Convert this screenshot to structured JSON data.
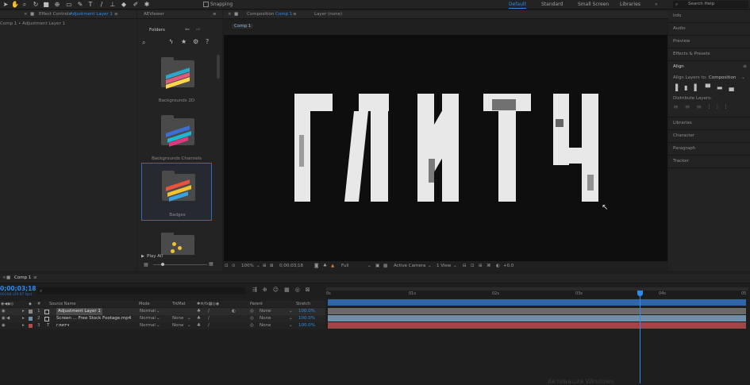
{
  "toolbar": {
    "snapping_label": "Snapping",
    "search_placeholder": "Search Help",
    "workspaces": [
      "Default",
      "Standard",
      "Small Screen",
      "Libraries"
    ]
  },
  "effect_controls": {
    "tab_label": "Effect Controls",
    "tab_target": "Adjustment Layer 1",
    "breadcrumb": "Comp 1 • Adjustment Layer 1"
  },
  "aeviewer": {
    "tab_label": "AEViewer",
    "folders_label": "Folders",
    "folders": [
      "Backgrounds 2D",
      "Backgrounds Channels",
      "Badges",
      ""
    ],
    "play_all_label": "Play All"
  },
  "composition": {
    "tab_prefix": "Composition",
    "tab_name": "Comp 1",
    "layer_tab": "Layer (none)",
    "sub_tab": "Comp 1",
    "zoom": "100%",
    "timecode": "0;00;03;18",
    "resolution": "Full",
    "camera": "Active Camera",
    "views": "1 View",
    "exposure": "+0.0"
  },
  "right_panel": {
    "items": [
      "Info",
      "Audio",
      "Preview",
      "Effects & Presets",
      "Align"
    ],
    "align_to_label": "Align Layers to:",
    "align_to_value": "Composition",
    "distribute_label": "Distribute Layers:",
    "items_after": [
      "Libraries",
      "Character",
      "Paragraph",
      "Tracker"
    ]
  },
  "timeline": {
    "tab_label": "Comp 1",
    "timecode": "0;00;03;18",
    "timecode_sub": "00108 (29.97 fps)",
    "columns": {
      "source": "Source Name",
      "mode": "Mode",
      "trkmat": "TrkMat",
      "parent": "Parent",
      "stretch": "Stretch"
    },
    "layers": [
      {
        "num": "1",
        "name": "Adjustment Layer 1",
        "mode": "Normal",
        "trkmat": "",
        "parent": "None",
        "stretch": "100.0%",
        "color": "#8a8a8a"
      },
      {
        "num": "2",
        "name": "Screen ... Free Stock Footage.mp4",
        "mode": "Normal",
        "trkmat": "None",
        "parent": "None",
        "stretch": "100.0%",
        "color": "#6f8ea8"
      },
      {
        "num": "3",
        "name": "глитч",
        "mode": "Normal",
        "trkmat": "None",
        "parent": "None",
        "stretch": "100.0%",
        "color": "#b24c4c"
      }
    ],
    "ticks": [
      "0s",
      "01s",
      "02s",
      "03s",
      "04s",
      "05"
    ],
    "playhead_fraction": 0.745
  },
  "overlay": {
    "watermark": "Активация Windows"
  }
}
